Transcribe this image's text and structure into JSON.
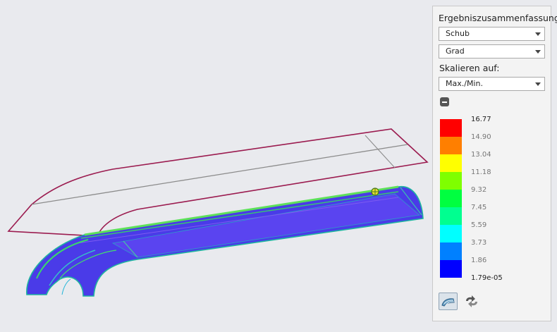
{
  "panel": {
    "title": "Ergebniszusammenfassung",
    "result_type": "Schub",
    "unit": "Grad",
    "scale_label": "Skalieren auf:",
    "scale_mode": "Max./Min."
  },
  "legend": {
    "labels": [
      "16.77",
      "14.90",
      "13.04",
      "11.18",
      "9.32",
      "7.45",
      "5.59",
      "3.73",
      "1.86",
      "1.79e-05"
    ],
    "colors": [
      "#ff0000",
      "#ff7f00",
      "#ffff00",
      "#7fff00",
      "#00ff40",
      "#00ff90",
      "#00ffff",
      "#0080ff",
      "#0000ff"
    ]
  },
  "icons": {
    "collapse": "minus-icon",
    "display_mode": "shaded-mesh-icon",
    "refresh": "sync-arrows-icon"
  }
}
